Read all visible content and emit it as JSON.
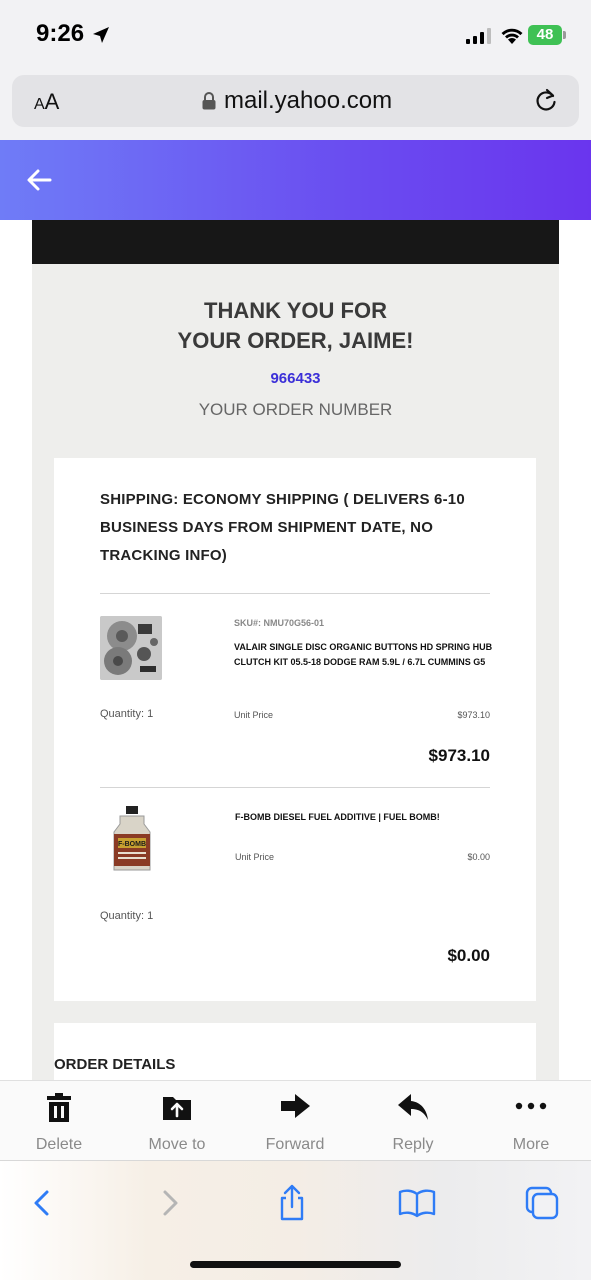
{
  "status_bar": {
    "time": "9:26",
    "battery": "48"
  },
  "browser": {
    "text_size_label": "AA",
    "url": "mail.yahoo.com"
  },
  "email": {
    "thanks_line1": "THANK YOU FOR",
    "thanks_line2": "YOUR ORDER, JAIME!",
    "order_number": "966433",
    "order_number_label": "YOUR ORDER NUMBER",
    "shipping": "SHIPPING: ECONOMY SHIPPING ( DELIVERS 6-10 BUSINESS DAYS FROM SHIPMENT DATE, NO TRACKING INFO)",
    "items": [
      {
        "sku": "SKU#: NMU70G56-01",
        "name": "VALAIR SINGLE DISC ORGANIC BUTTONS HD SPRING HUB CLUTCH KIT 05.5-18 DODGE RAM 5.9L / 6.7L CUMMINS G5",
        "quantity": "Quantity: 1",
        "unit_price_label": "Unit Price",
        "unit_price": "$973.10",
        "total": "$973.10"
      },
      {
        "name": "F-BOMB DIESEL FUEL ADDITIVE | FUEL BOMB!",
        "quantity": "Quantity: 1",
        "unit_price_label": "Unit Price",
        "unit_price": "$0.00",
        "total": "$0.00",
        "bottle_label": "F-BOMB"
      }
    ],
    "order_details_heading": "ORDER DETAILS"
  },
  "mail_toolbar": [
    {
      "label": "Delete",
      "icon": "trash-icon"
    },
    {
      "label": "Move to",
      "icon": "move-to-folder-icon"
    },
    {
      "label": "Forward",
      "icon": "forward-arrow-icon"
    },
    {
      "label": "Reply",
      "icon": "reply-arrow-icon"
    },
    {
      "label": "More",
      "icon": "more-dots-icon"
    }
  ],
  "safari_toolbar": [
    "back-chevron-icon",
    "forward-chevron-icon",
    "share-icon",
    "bookmarks-icon",
    "tabs-icon"
  ],
  "colors": {
    "header_gradient_start": "#6f7cf7",
    "header_gradient_end": "#6a35ee",
    "order_number": "#3b2fd8",
    "safari_accent": "#2f7cf6",
    "battery": "#3fc154"
  }
}
